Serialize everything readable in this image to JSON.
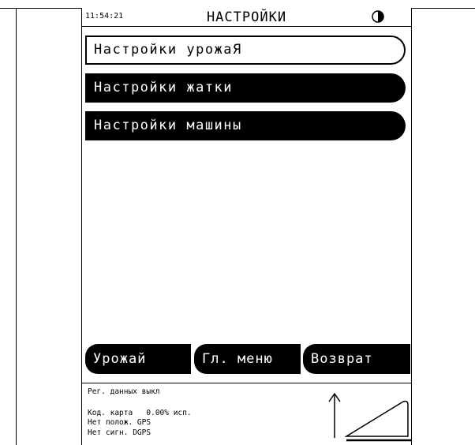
{
  "header": {
    "time": "11:54:21",
    "title": "НАСТРОЙКИ",
    "contrast_icon": "contrast-half-circle-icon"
  },
  "menu": {
    "items": [
      {
        "label": "Настройки урожаЯ",
        "selected": true
      },
      {
        "label": "Настройки жатки",
        "selected": false
      },
      {
        "label": "Настройки машины",
        "selected": false
      }
    ]
  },
  "softkeys": {
    "harvest": "Урожай",
    "main_menu": "Гл. меню",
    "back": "Возврат"
  },
  "status": {
    "data_logging": "Рег. данных выкл",
    "map_code": "Код. карта",
    "map_usage": "0.00% исп.",
    "no_position": "Нет полож. GPS",
    "no_signal": "Нет сигн. DGPS",
    "gps_graphic_icon": "north-arrow-slope-icon"
  },
  "colors": {
    "foreground": "#000000",
    "background": "#ffffff"
  }
}
